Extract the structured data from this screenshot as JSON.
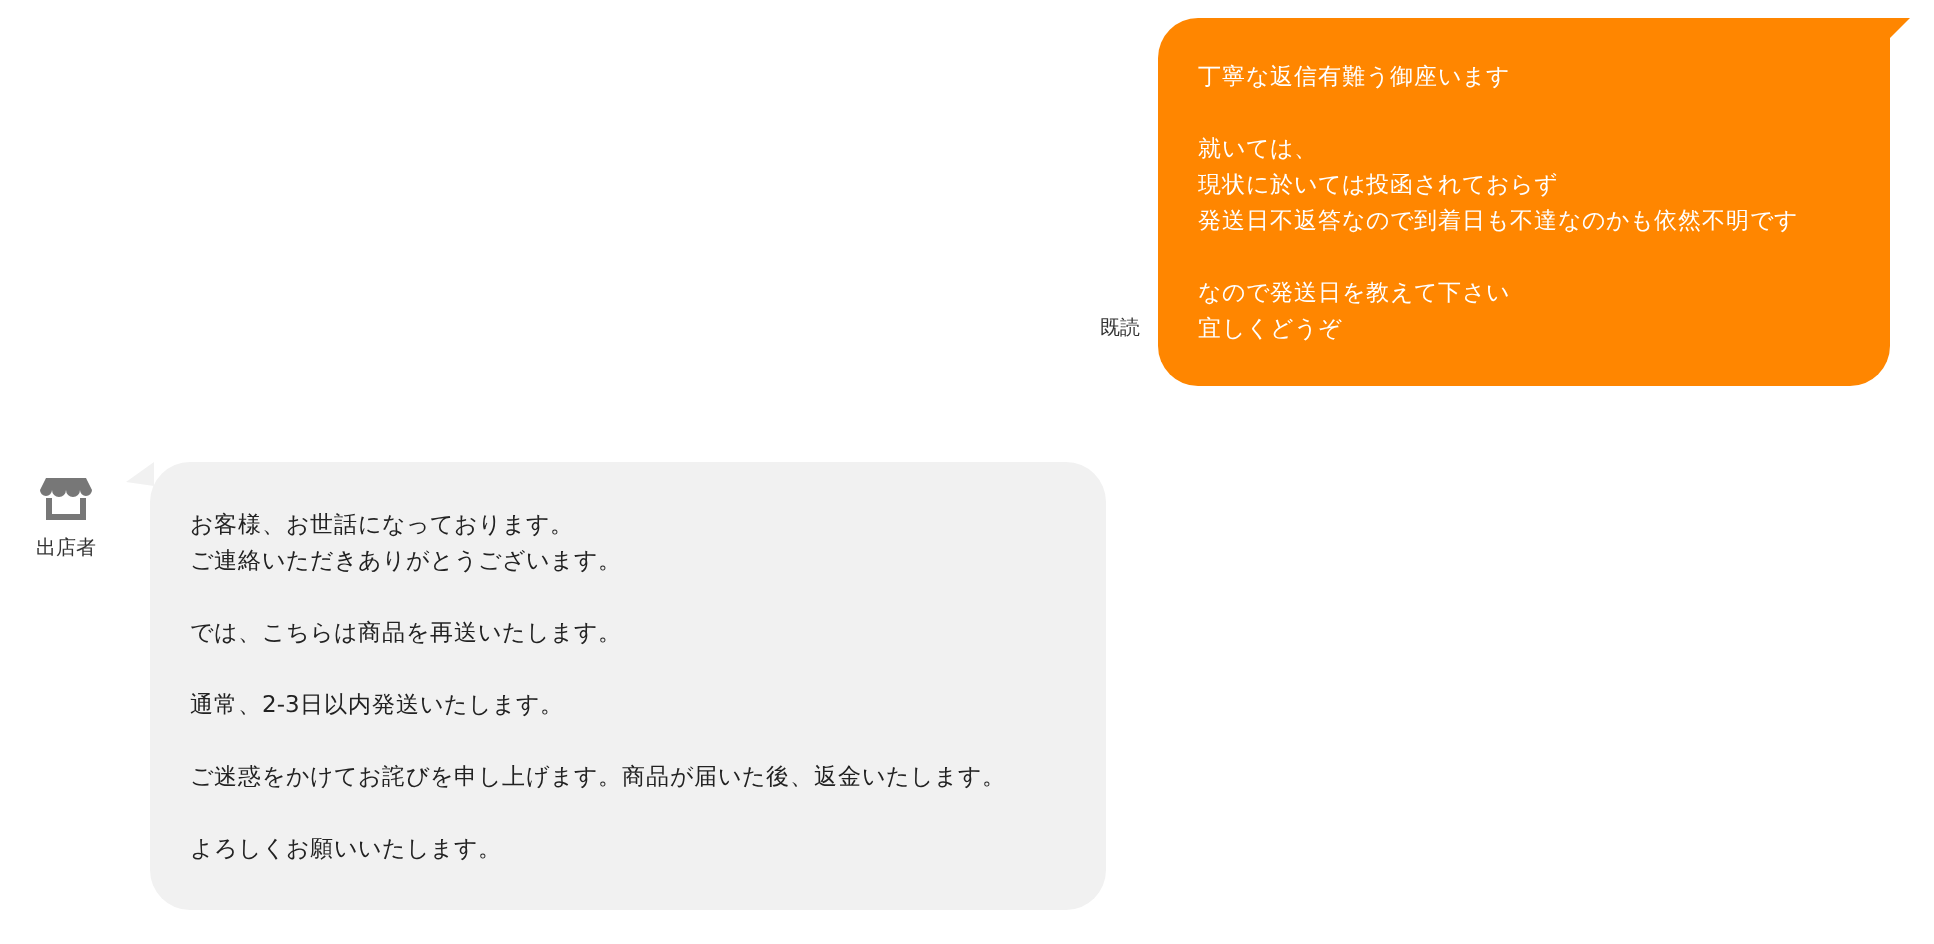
{
  "messages": [
    {
      "kind": "sent",
      "status": "既読",
      "paragraphs": [
        [
          "丁寧な返信有難う御座います"
        ],
        [
          "就いては、",
          "現状に於いては投函されておらず",
          "発送日不返答なので到着日も不達なのかも依然不明です"
        ],
        [
          "なので発送日を教えて下さい",
          "宜しくどうぞ"
        ]
      ]
    },
    {
      "kind": "received",
      "sender": "出店者",
      "paragraphs": [
        [
          "お客様、お世話になっております。",
          "ご連絡いただきありがとうございます。"
        ],
        [
          "では、こちらは商品を再送いたします。"
        ],
        [
          "通常、2-3日以内発送いたします。"
        ],
        [
          "ご迷惑をかけてお詫びを申し上げます。商品が届いた後、返金いたします。"
        ],
        [
          "よろしくお願いいたします。"
        ]
      ]
    }
  ]
}
